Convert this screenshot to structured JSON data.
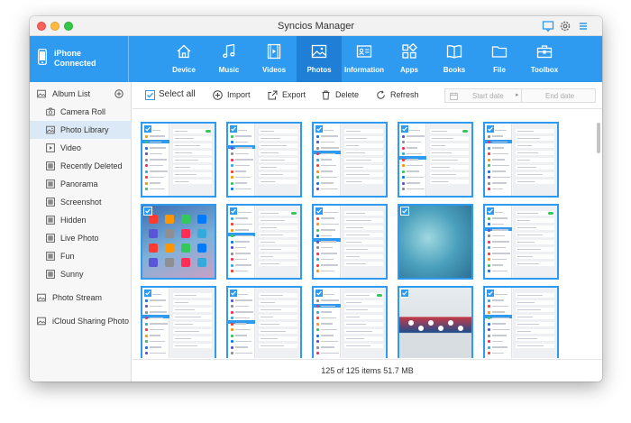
{
  "window": {
    "title": "Syncios Manager"
  },
  "device": {
    "name": "iPhone",
    "status": "Connected"
  },
  "nav": [
    {
      "label": "Device",
      "icon": "home-icon"
    },
    {
      "label": "Music",
      "icon": "music-note-icon"
    },
    {
      "label": "Videos",
      "icon": "film-icon"
    },
    {
      "label": "Photos",
      "icon": "photo-icon",
      "active": true
    },
    {
      "label": "Information",
      "icon": "contact-card-icon"
    },
    {
      "label": "Apps",
      "icon": "apps-grid-icon"
    },
    {
      "label": "Books",
      "icon": "book-icon"
    },
    {
      "label": "File",
      "icon": "folder-icon"
    },
    {
      "label": "Toolbox",
      "icon": "toolbox-icon"
    }
  ],
  "sidebar": {
    "album_list": "Album List",
    "items": [
      {
        "label": "Camera Roll",
        "icon": "camera-icon"
      },
      {
        "label": "Photo Library",
        "icon": "photo-library-icon",
        "active": true
      },
      {
        "label": "Video",
        "icon": "video-play-icon"
      },
      {
        "label": "Recently Deleted",
        "icon": "album-icon"
      },
      {
        "label": "Panorama",
        "icon": "album-icon"
      },
      {
        "label": "Screenshot",
        "icon": "album-icon"
      },
      {
        "label": "Hidden",
        "icon": "album-icon"
      },
      {
        "label": "Live Photo",
        "icon": "album-icon"
      },
      {
        "label": "Fun",
        "icon": "album-icon"
      },
      {
        "label": "Sunny",
        "icon": "album-icon"
      }
    ],
    "photo_stream": "Photo Stream",
    "icloud": "iCloud Sharing Photo"
  },
  "toolbar": {
    "select_all": "Select all",
    "import": "Import",
    "export": "Export",
    "delete": "Delete",
    "refresh": "Refresh",
    "start_date": "Start date",
    "end_date": "End date"
  },
  "status": {
    "text": "125 of 125 items 51.7 MB"
  },
  "colors": {
    "accent": "#2e9af0",
    "accent_dark": "#1f7fd6",
    "sidebar_active": "#dbe9f6"
  },
  "photos": [
    {
      "kind": "settings"
    },
    {
      "kind": "settings"
    },
    {
      "kind": "settings"
    },
    {
      "kind": "settings"
    },
    {
      "kind": "settings"
    },
    {
      "kind": "homescreen"
    },
    {
      "kind": "settings"
    },
    {
      "kind": "settings"
    },
    {
      "kind": "wallpaper"
    },
    {
      "kind": "settings"
    },
    {
      "kind": "settings"
    },
    {
      "kind": "settings"
    },
    {
      "kind": "settings"
    },
    {
      "kind": "photo"
    },
    {
      "kind": "settings"
    }
  ]
}
